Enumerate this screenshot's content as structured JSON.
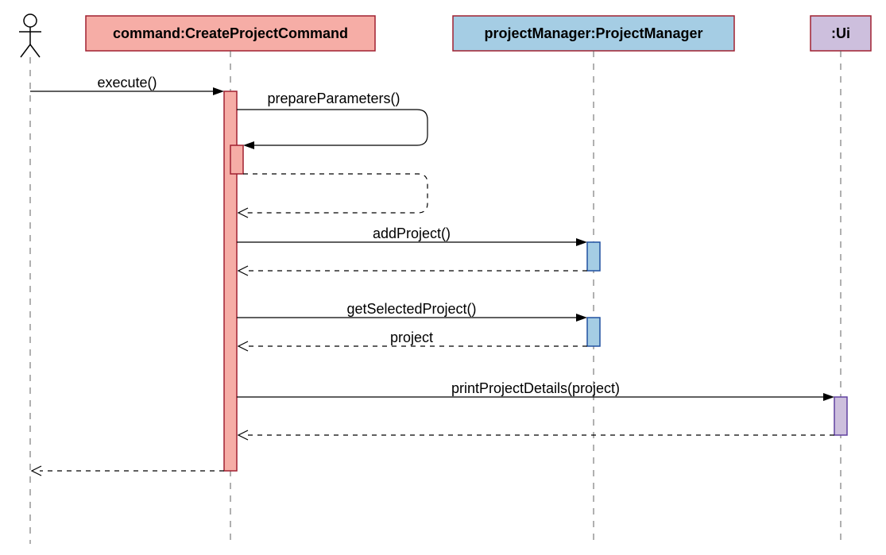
{
  "chart_data": {
    "type": "sequence-diagram",
    "participants": [
      {
        "id": "actor",
        "name": "",
        "kind": "actor"
      },
      {
        "id": "command",
        "name": "command:CreateProjectCommand",
        "kind": "lifeline",
        "fill": "#F6ADA6",
        "stroke": "#a02030"
      },
      {
        "id": "projectManager",
        "name": "projectManager:ProjectManager",
        "kind": "lifeline",
        "fill": "#A5CDE4",
        "stroke": "#2050a0"
      },
      {
        "id": "ui",
        "name": ":Ui",
        "kind": "lifeline",
        "fill": "#CDBFDD",
        "stroke": "#6040a0"
      }
    ],
    "messages": [
      {
        "from": "actor",
        "to": "command",
        "label": "execute()",
        "type": "call"
      },
      {
        "from": "command",
        "to": "command",
        "label": "prepareParameters()",
        "type": "self-call"
      },
      {
        "from": "command",
        "to": "command",
        "label": "",
        "type": "self-return"
      },
      {
        "from": "command",
        "to": "projectManager",
        "label": "addProject()",
        "type": "call"
      },
      {
        "from": "projectManager",
        "to": "command",
        "label": "",
        "type": "return"
      },
      {
        "from": "command",
        "to": "projectManager",
        "label": "getSelectedProject()",
        "type": "call"
      },
      {
        "from": "projectManager",
        "to": "command",
        "label": "project",
        "type": "return"
      },
      {
        "from": "command",
        "to": "ui",
        "label": "printProjectDetails(project)",
        "type": "call"
      },
      {
        "from": "ui",
        "to": "command",
        "label": "",
        "type": "return"
      },
      {
        "from": "command",
        "to": "actor",
        "label": "",
        "type": "return"
      }
    ]
  },
  "labels": {
    "p0": "command:CreateProjectCommand",
    "p1": "projectManager:ProjectManager",
    "p2": ":Ui",
    "m0": "execute()",
    "m1": "prepareParameters()",
    "m3": "addProject()",
    "m5": "getSelectedProject()",
    "m6": "project",
    "m7": "printProjectDetails(project)"
  }
}
